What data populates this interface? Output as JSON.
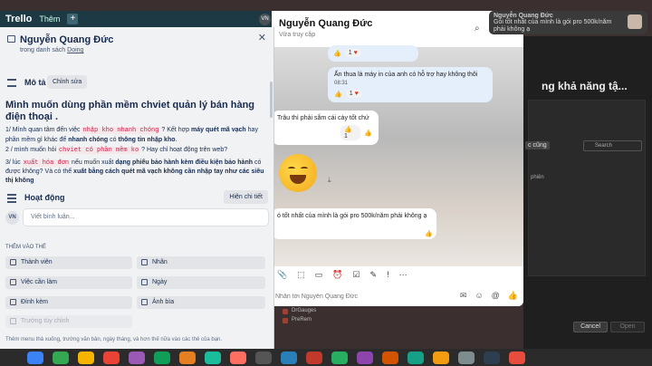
{
  "trello_topbar": {
    "logo": "Trello",
    "menu": "Thêm",
    "plus": "+",
    "avatar": "VN"
  },
  "card": {
    "title": "Nguyễn Quang Đức",
    "list_prefix": "trong danh sách ",
    "list_name": "Doing",
    "close": "✕",
    "description_label": "Mô tả",
    "edit_button": "Chỉnh sửa",
    "heading": "Mình muốn dùng phần mềm chviet quản lý bán hàng điện thoại .",
    "line1_a": "1/ Mình quan tâm đến việc ",
    "line1_code": "nhập kho nhanh chóng",
    "line1_b": " ? Kết hợp ",
    "line1_bold1": "máy quét mã vạch",
    "line1_c": " hay phần mềm gì khác để ",
    "line1_bold2": "nhanh chóng",
    "line1_d": " có ",
    "line1_bold3": "thông tin nhập kho",
    "line1_e": ".",
    "line2_a": "2 / mình muốn hỏi ",
    "line2_code": "chviet có phần mềm ko",
    "line2_b": " ? Hay chỉ hoạt động trên web?",
    "line3_a": "3/ lúc ",
    "line3_code": "xuất hóa đơn",
    "line3_b": " nếu muốn xuất ",
    "line3_bold1": "dạng phiếu bảo hành kèm điều kiện bảo hành",
    "line3_c": " có được không? Và có thể ",
    "line3_bold2": "xuất bằng cách quét mã vạch không cần nhập tay như các siêu thị không",
    "activity_label": "Hoạt động",
    "activity_detail": "Hiện chi tiết",
    "avatar": "VN",
    "comment_placeholder": "Viết bình luận...",
    "add_to_card": "THÊM VÀO THẺ",
    "buttons": [
      "Thành viên",
      "Nhãn",
      "Việc cần làm",
      "Ngày",
      "Đính kèm",
      "Ảnh bìa"
    ],
    "custom_field": "Trường tùy chỉnh",
    "footer": "Thêm menu thả xuống, trường văn bản, ngày tháng, và hơn thế nữa vào các thẻ của bạn."
  },
  "messenger": {
    "name": "Nguyễn Quang Đức",
    "status": "Vừa truy cập",
    "icons": [
      "search-icon",
      "phone-icon",
      "more-icon"
    ],
    "msg1_react_count": "1",
    "msg2_text": "Ấn thua là máy in của anh có hỗ trợ hay không thôi",
    "msg2_time": "08:31",
    "msg2_react_count": "1",
    "msg3_text": "Trâu thì phải sắm cái cày tốt chứ",
    "msg3_react_count": "1",
    "msg4_text": "ó tốt nhất của mình là gói pro 500k/năm phải không ạ",
    "compose_placeholder": "Nhắn tới Nguyễn Quang Đức"
  },
  "notification": {
    "title": "Nguyễn Quang Đức",
    "message": "Gói tốt nhất của mình là gói pro 500k/năm phải không ạ"
  },
  "right_area": {
    "big_text": "ng khả năng tậ...",
    "tag": "c cũng",
    "search": "Search",
    "phien": "phiên",
    "cancel": "Cancel",
    "open": "Open"
  },
  "board_list": [
    "DrGauges",
    "PreRem"
  ],
  "colors": {
    "dock": [
      "#3b82f6",
      "#34a853",
      "#f4b400",
      "#ea4335",
      "#9b59b6",
      "#0f9d58",
      "#e67e22",
      "#1abc9c",
      "#ff6f61",
      "#555555",
      "#2980b9",
      "#c0392b",
      "#27ae60",
      "#8e44ad",
      "#d35400",
      "#16a085",
      "#f39c12",
      "#7f8c8d",
      "#2c3e50",
      "#e74c3c"
    ]
  }
}
